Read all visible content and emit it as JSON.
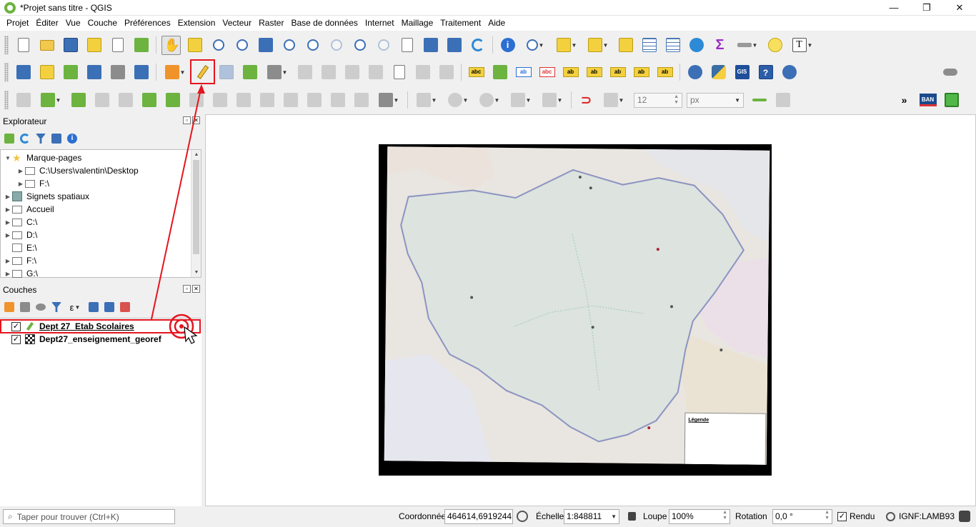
{
  "window": {
    "title": "*Projet sans titre - QGIS",
    "minimize": "—",
    "restore": "❐",
    "close": "✕"
  },
  "menu": [
    "Projet",
    "Éditer",
    "Vue",
    "Couche",
    "Préférences",
    "Extension",
    "Vecteur",
    "Raster",
    "Base de données",
    "Internet",
    "Maillage",
    "Traitement",
    "Aide"
  ],
  "toolbar3": {
    "snap_tolerance": "12",
    "snap_unit": "px",
    "more": "»",
    "ban_label": "BAN"
  },
  "browser": {
    "title": "Explorateur",
    "items": [
      {
        "label": "Marque-pages",
        "level": 0,
        "expanded": true,
        "icon": "star-icon"
      },
      {
        "label": "C:\\Users\\valentin\\Desktop",
        "level": 1,
        "icon": "folder-icon"
      },
      {
        "label": "F:\\",
        "level": 1,
        "icon": "folder-icon"
      },
      {
        "label": "Signets spatiaux",
        "level": 0,
        "icon": "bookmark-icon"
      },
      {
        "label": "Accueil",
        "level": 0,
        "icon": "folder-icon"
      },
      {
        "label": "C:\\",
        "level": 0,
        "icon": "drive-icon"
      },
      {
        "label": "D:\\",
        "level": 0,
        "icon": "drive-icon"
      },
      {
        "label": "E:\\",
        "level": 0,
        "icon": "drive-icon"
      },
      {
        "label": "F:\\",
        "level": 0,
        "icon": "drive-icon"
      },
      {
        "label": "G:\\",
        "level": 0,
        "icon": "drive-icon"
      }
    ]
  },
  "layers": {
    "title": "Couches",
    "items": [
      {
        "label": "Dept 27_Etab Scolaires",
        "checked": "✓",
        "icon": "pencil-edit-icon"
      },
      {
        "label": "Dept27_enseignement_georef",
        "checked": "✓",
        "icon": "raster-icon"
      }
    ]
  },
  "map": {
    "legend_title": "Légende"
  },
  "status": {
    "search_placeholder": "Taper pour trouver (Ctrl+K)",
    "coord_label": "Coordonnée",
    "coord_value": "464614,6919244",
    "scale_label": "Échelle",
    "scale_value": "1:848811",
    "zoom_label": "Loupe",
    "zoom_value": "100%",
    "rotation_label": "Rotation",
    "rotation_value": "0,0 °",
    "render_label": "Rendu",
    "render_checked": "✓",
    "crs": "IGNF:LAMB93"
  }
}
